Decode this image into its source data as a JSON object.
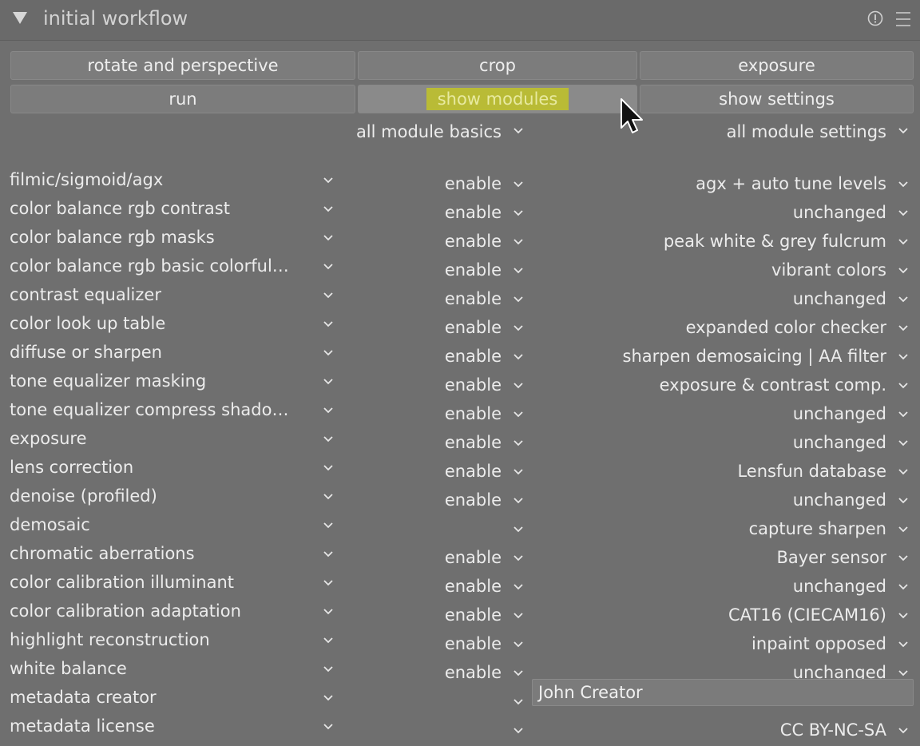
{
  "header": {
    "title": "initial workflow"
  },
  "buttons": {
    "row1": [
      "rotate and perspective",
      "crop",
      "exposure"
    ],
    "row2": [
      "run",
      "show modules",
      "show settings"
    ]
  },
  "columns": {
    "basics_header": "all module basics",
    "settings_header": "all module settings"
  },
  "rows": [
    {
      "module": "filmic/sigmoid/agx",
      "basic": "enable",
      "setting": "agx + auto tune levels"
    },
    {
      "module": "color balance rgb contrast",
      "basic": "enable",
      "setting": "unchanged"
    },
    {
      "module": "color balance rgb masks",
      "basic": "enable",
      "setting": "peak white & grey fulcrum"
    },
    {
      "module": "color balance rgb basic colorfulness",
      "basic": "enable",
      "setting": "vibrant colors"
    },
    {
      "module": "contrast equalizer",
      "basic": "enable",
      "setting": "unchanged"
    },
    {
      "module": "color look up table",
      "basic": "enable",
      "setting": "expanded color checker"
    },
    {
      "module": "diffuse or sharpen",
      "basic": "enable",
      "setting": "sharpen demosaicing | AA filter"
    },
    {
      "module": "tone equalizer masking",
      "basic": "enable",
      "setting": "exposure & contrast comp."
    },
    {
      "module": "tone equalizer compress shado…",
      "basic": "enable",
      "setting": "unchanged"
    },
    {
      "module": "exposure",
      "basic": "enable",
      "setting": "unchanged"
    },
    {
      "module": "lens correction",
      "basic": "enable",
      "setting": "Lensfun database"
    },
    {
      "module": "denoise (profiled)",
      "basic": "enable",
      "setting": "unchanged"
    },
    {
      "module": "demosaic",
      "basic": "",
      "setting": "capture sharpen"
    },
    {
      "module": "chromatic aberrations",
      "basic": "enable",
      "setting": "Bayer sensor"
    },
    {
      "module": "color calibration illuminant",
      "basic": "enable",
      "setting": "unchanged"
    },
    {
      "module": "color calibration adaptation",
      "basic": "enable",
      "setting": "CAT16 (CIECAM16)"
    },
    {
      "module": "highlight reconstruction",
      "basic": "enable",
      "setting": "inpaint opposed"
    },
    {
      "module": "white balance",
      "basic": "enable",
      "setting": "unchanged"
    },
    {
      "module": "metadata creator",
      "basic": "",
      "setting": "John Creator",
      "setting_is_input": true
    },
    {
      "module": "metadata license",
      "basic": "",
      "setting": "CC BY-NC-SA"
    }
  ]
}
